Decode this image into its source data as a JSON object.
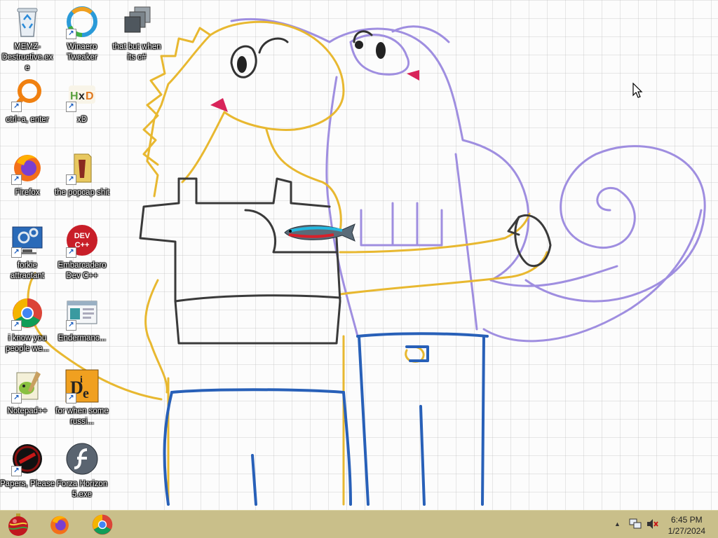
{
  "desktop": {
    "icons": [
      {
        "label": "MEMZ-Destructive.exe",
        "icon": "recycle-bin-icon"
      },
      {
        "label": "Winaero Tweaker",
        "icon": "winaero-icon"
      },
      {
        "label": "that but when its c#",
        "icon": "stacked-windows-icon"
      },
      {
        "label": "ctrl+a, enter",
        "icon": "search-magnifier-icon"
      },
      {
        "label": "xD",
        "icon": "hxd-icon"
      },
      {
        "label": "Firefox",
        "icon": "firefox-icon"
      },
      {
        "label": "the popcap shit",
        "icon": "folder-icon"
      },
      {
        "label": "forkie attractant",
        "icon": "computer-settings-icon"
      },
      {
        "label": "Embarcadero Dev C++",
        "icon": "devcpp-icon"
      },
      {
        "label": "i know you people we...",
        "icon": "chrome-icon"
      },
      {
        "label": "Endermanc...",
        "icon": "window-app-icon"
      },
      {
        "label": "Notepad++",
        "icon": "notepadpp-icon"
      },
      {
        "label": "for when some russi...",
        "icon": "die-icon"
      },
      {
        "label": "Papers, Please",
        "icon": "papers-please-icon"
      },
      {
        "label": "Forza Horizon 5.exe",
        "icon": "flash-icon"
      }
    ]
  },
  "taskbar": {
    "pinned": [
      {
        "icon": "ornament-start-icon"
      },
      {
        "icon": "firefox-icon"
      },
      {
        "icon": "chrome-icon"
      }
    ],
    "tray": {
      "show_hidden_glyph": "▲",
      "network_icon": "network-icon",
      "volume_icon": "volume-muted-icon"
    },
    "clock": {
      "time": "6:45 PM",
      "date": "1/27/2024"
    }
  },
  "colors": {
    "taskbar_bg": "#c9bf8a",
    "yellow_lizard": "#e8b830",
    "purple_lizard": "#9f8ee0",
    "jeans": "#2860b8",
    "shirt": "#3a3a3a"
  }
}
